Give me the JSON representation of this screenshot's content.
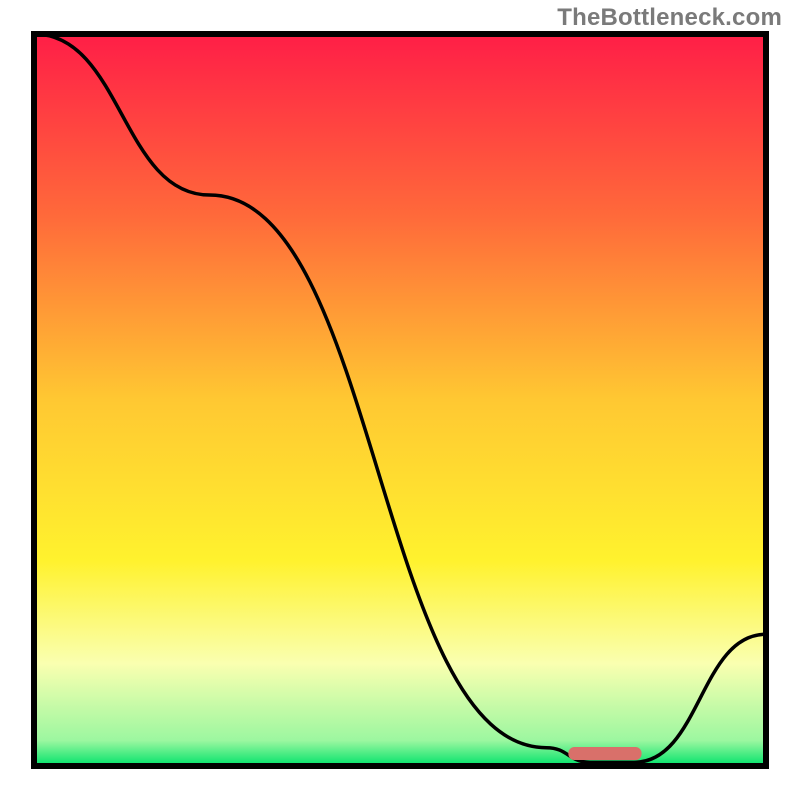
{
  "watermark": "TheBottleneck.com",
  "chart_data": {
    "type": "line",
    "title": "",
    "xlabel": "",
    "ylabel": "",
    "xlim": [
      0,
      100
    ],
    "ylim": [
      0,
      100
    ],
    "x": [
      0,
      24,
      70,
      76,
      82,
      100
    ],
    "values": [
      100,
      78,
      2.5,
      0.5,
      0.5,
      18
    ],
    "marker": {
      "shape": "rounded-bar",
      "x_start": 73,
      "x_end": 83,
      "y": 1.7,
      "color": "#d9706a"
    },
    "background_gradient": {
      "stops": [
        {
          "offset": 0,
          "color": "#ff1e47"
        },
        {
          "offset": 0.25,
          "color": "#ff6a3a"
        },
        {
          "offset": 0.5,
          "color": "#ffc832"
        },
        {
          "offset": 0.72,
          "color": "#fff22e"
        },
        {
          "offset": 0.86,
          "color": "#faffb0"
        },
        {
          "offset": 0.965,
          "color": "#9cf7a0"
        },
        {
          "offset": 1.0,
          "color": "#00e26a"
        }
      ]
    },
    "axes_visible": false,
    "grid": false,
    "frame": {
      "color": "#000000",
      "width": 6
    }
  }
}
